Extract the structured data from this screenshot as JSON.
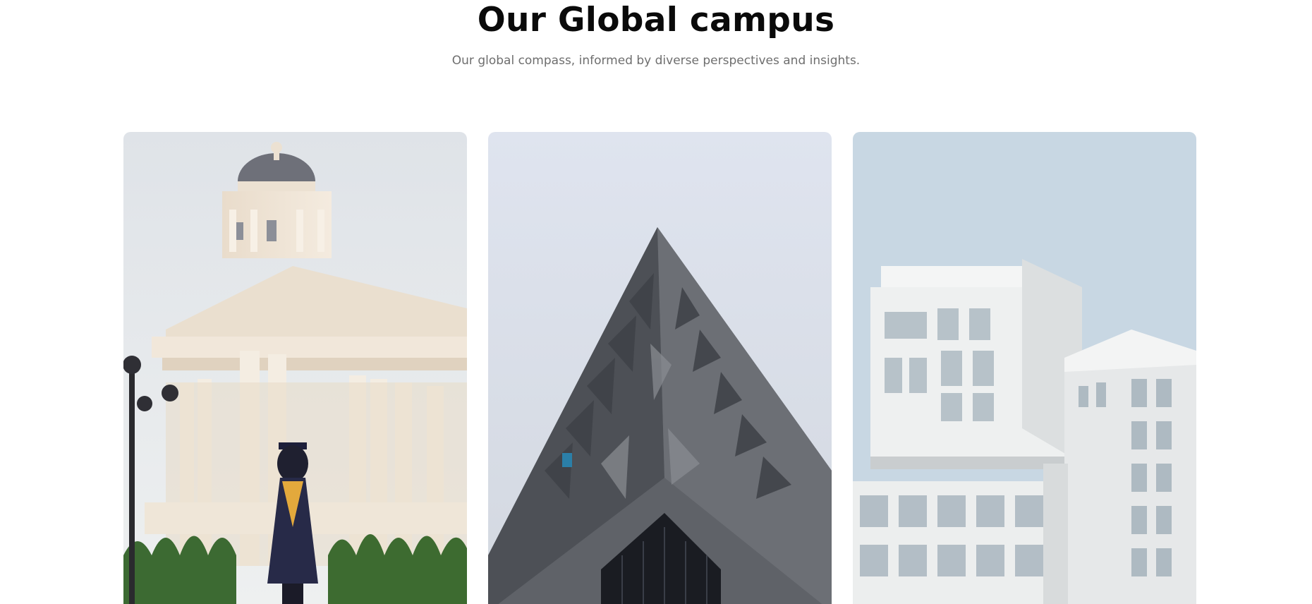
{
  "section": {
    "title": "Our Global campus",
    "subtitle": "Our global compass, informed by diverse perspectives and insights."
  },
  "campus_images": [
    {
      "subject": "domed neoclassical building with graduate"
    },
    {
      "subject": "angular dark metal-clad building"
    },
    {
      "subject": "white modular apartment building"
    }
  ]
}
